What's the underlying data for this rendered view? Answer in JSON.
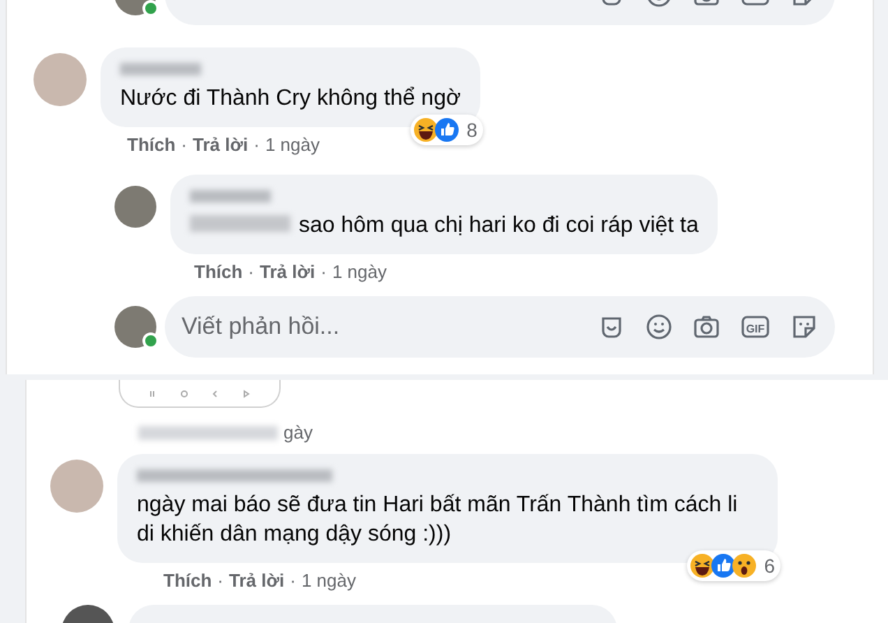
{
  "top_panel": {
    "cut_composer": {
      "online": true,
      "icons": [
        {
          "kind": "sticker-face"
        },
        {
          "kind": "emoji"
        },
        {
          "kind": "camera"
        },
        {
          "kind": "gif"
        },
        {
          "kind": "sticker"
        }
      ]
    },
    "comment": {
      "name_blurred": true,
      "text": "Nước đi Thành Cry không thể ngờ",
      "reactions": [
        {
          "kind": "haha"
        },
        {
          "kind": "like"
        }
      ],
      "reaction_count": "8",
      "actions": [
        "Thích",
        "Trả lời"
      ],
      "separator": "·",
      "time": "1 ngày"
    },
    "reply": {
      "name_blurred": true,
      "mention_blurred": true,
      "text": "sao hôm qua chị hari ko đi coi ráp việt ta",
      "actions": [
        "Thích",
        "Trả lời"
      ],
      "separator": "·",
      "time": "1 ngày"
    },
    "composer": {
      "placeholder": "Viết phản hồi...",
      "online": true,
      "icons": [
        {
          "kind": "sticker-face"
        },
        {
          "kind": "emoji"
        },
        {
          "kind": "camera"
        },
        {
          "kind": "gif",
          "label": "GIF"
        },
        {
          "kind": "sticker"
        }
      ]
    }
  },
  "bottom_panel": {
    "prev_time": "gày",
    "comment": {
      "name_blurred": true,
      "text": "ngày mai báo sẽ đưa tin Hari bất mãn Trấn Thành tìm cách li di khiến dân mạng dậy sóng :)))",
      "reactions": [
        {
          "kind": "haha"
        },
        {
          "kind": "like"
        },
        {
          "kind": "wow"
        }
      ],
      "reaction_count": "6",
      "actions": [
        "Thích",
        "Trả lời"
      ],
      "separator": "·",
      "time": "1 ngày"
    }
  }
}
